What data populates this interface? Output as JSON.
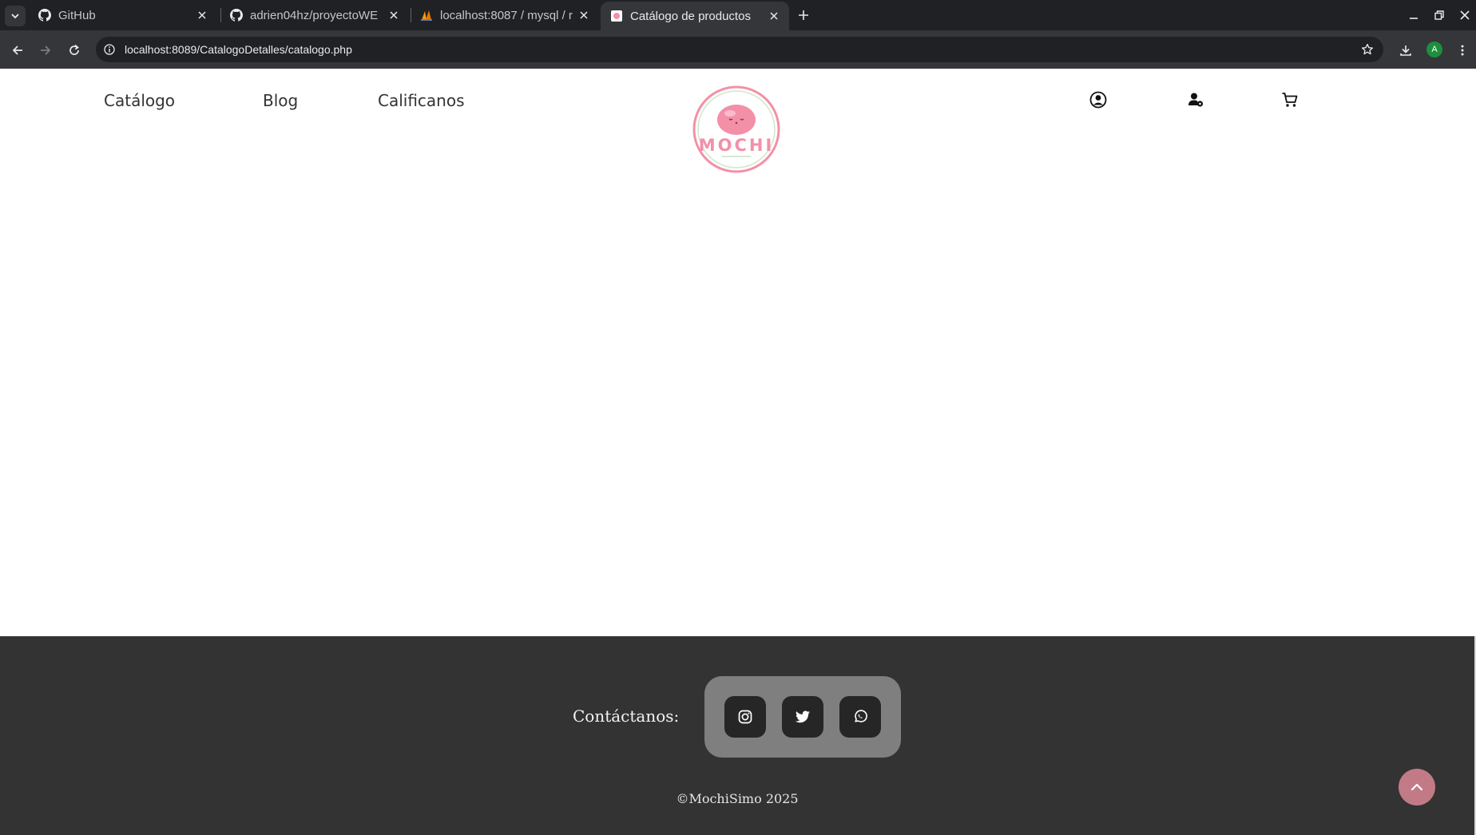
{
  "browser": {
    "tabs": [
      {
        "title": "GitHub",
        "favicon": "github-icon",
        "active": false
      },
      {
        "title": "adrien04hz/proyectoWE",
        "favicon": "github-icon",
        "active": false
      },
      {
        "title": "localhost:8087 / mysql / r",
        "favicon": "phpmyadmin-icon",
        "active": false
      },
      {
        "title": "Catálogo de productos",
        "favicon": "mochi-favicon",
        "active": true
      }
    ],
    "url": "localhost:8089/CatalogoDetalles/catalogo.php",
    "profile_initial": "A"
  },
  "header": {
    "nav": [
      "Catálogo",
      "Blog",
      "Calificanos"
    ],
    "logo_text": "MOCHI",
    "icons": [
      "user-circle-icon",
      "user-settings-icon",
      "cart-icon"
    ]
  },
  "footer": {
    "contact_label": "Contáctanos:",
    "social": [
      "instagram-icon",
      "twitter-icon",
      "whatsapp-icon"
    ],
    "copyright": "©MochiSimo 2025"
  },
  "colors": {
    "chrome_dark": "#202124",
    "chrome_toolbar": "#35363a",
    "footer_bg": "#333333",
    "social_box": "#7f7f7f",
    "logo_pink": "#f48fa8",
    "back_to_top": "#c27b86"
  }
}
